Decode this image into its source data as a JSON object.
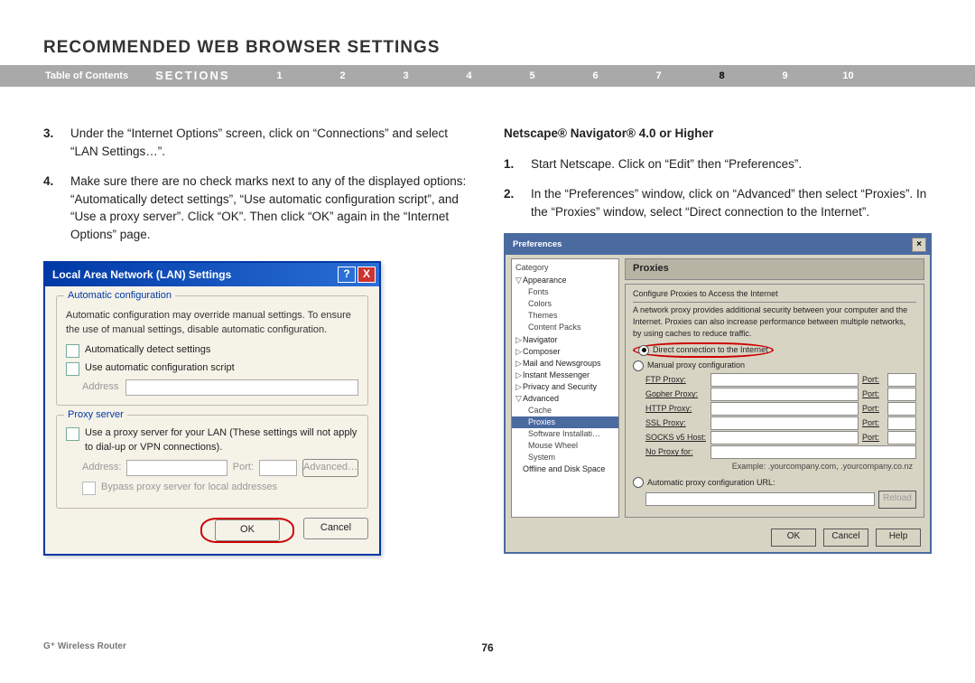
{
  "page_title": "RECOMMENDED WEB BROWSER SETTINGS",
  "nav": {
    "toc": "Table of Contents",
    "sections": "SECTIONS",
    "items": [
      "1",
      "2",
      "3",
      "4",
      "5",
      "6",
      "7",
      "8",
      "9",
      "10"
    ],
    "active": "8"
  },
  "left": {
    "step3_num": "3.",
    "step3": "Under the “Internet Options” screen, click on “Connections” and select “LAN Settings…”.",
    "step4_num": "4.",
    "step4": "Make sure there are no check marks next to any of the displayed options: “Automatically detect settings”, “Use automatic configuration script”, and “Use a proxy server”. Click “OK”. Then click “OK” again in the “Internet Options” page.",
    "lan": {
      "title": "Local Area Network (LAN) Settings",
      "auto_legend": "Automatic configuration",
      "auto_desc": "Automatic configuration may override manual settings.  To ensure the use of manual settings, disable automatic configuration.",
      "chk_detect": "Automatically detect settings",
      "chk_script": "Use automatic configuration script",
      "addr_lbl": "Address",
      "proxy_legend": "Proxy server",
      "chk_proxy": "Use a proxy server for your LAN (These settings will not apply to dial-up or VPN connections).",
      "addr2_lbl": "Address:",
      "port_lbl": "Port:",
      "advanced": "Advanced…",
      "bypass": "Bypass proxy server for local addresses",
      "ok": "OK",
      "cancel": "Cancel"
    }
  },
  "right": {
    "subhead": "Netscape® Navigator® 4.0 or Higher",
    "step1_num": "1.",
    "step1": "Start Netscape. Click on “Edit” then “Preferences”.",
    "step2_num": "2.",
    "step2": "In the “Preferences” window, click on “Advanced” then select “Proxies”. In the “Proxies” window, select “Direct connection to the Internet”.",
    "ns": {
      "title": "Preferences",
      "cat_head": "Category",
      "tree": {
        "appearance": "Appearance",
        "fonts": "Fonts",
        "colors": "Colors",
        "themes": "Themes",
        "content": "Content Packs",
        "navigator": "Navigator",
        "composer": "Composer",
        "mail": "Mail and Newsgroups",
        "im": "Instant Messenger",
        "privacy": "Privacy and Security",
        "advanced": "Advanced",
        "cache": "Cache",
        "proxies": "Proxies",
        "software": "Software Installati…",
        "mouse": "Mouse Wheel",
        "system": "System",
        "offline": "Offline and Disk Space"
      },
      "panel_head": "Proxies",
      "conf_desc": "Configure Proxies to Access the Internet",
      "net_desc": "A network proxy provides additional security between your computer and the Internet. Proxies can also increase performance between multiple networks, by using caches to reduce traffic.",
      "direct": "Direct connection to the Internet",
      "manual": "Manual proxy configuration",
      "rows": {
        "ftp": "FTP Proxy:",
        "gopher": "Gopher Proxy:",
        "http": "HTTP Proxy:",
        "ssl": "SSL Proxy:",
        "socks": "SOCKS v5 Host:",
        "noproxy": "No Proxy for:"
      },
      "port": "Port:",
      "example": "Example: .yourcompany.com, .yourcompany.co.nz",
      "auto_url": "Automatic proxy configuration URL:",
      "reload": "Reload",
      "ok": "OK",
      "cancel": "Cancel",
      "help": "Help"
    }
  },
  "footer": {
    "product": "G⁺ Wireless Router",
    "page_no": "76"
  }
}
